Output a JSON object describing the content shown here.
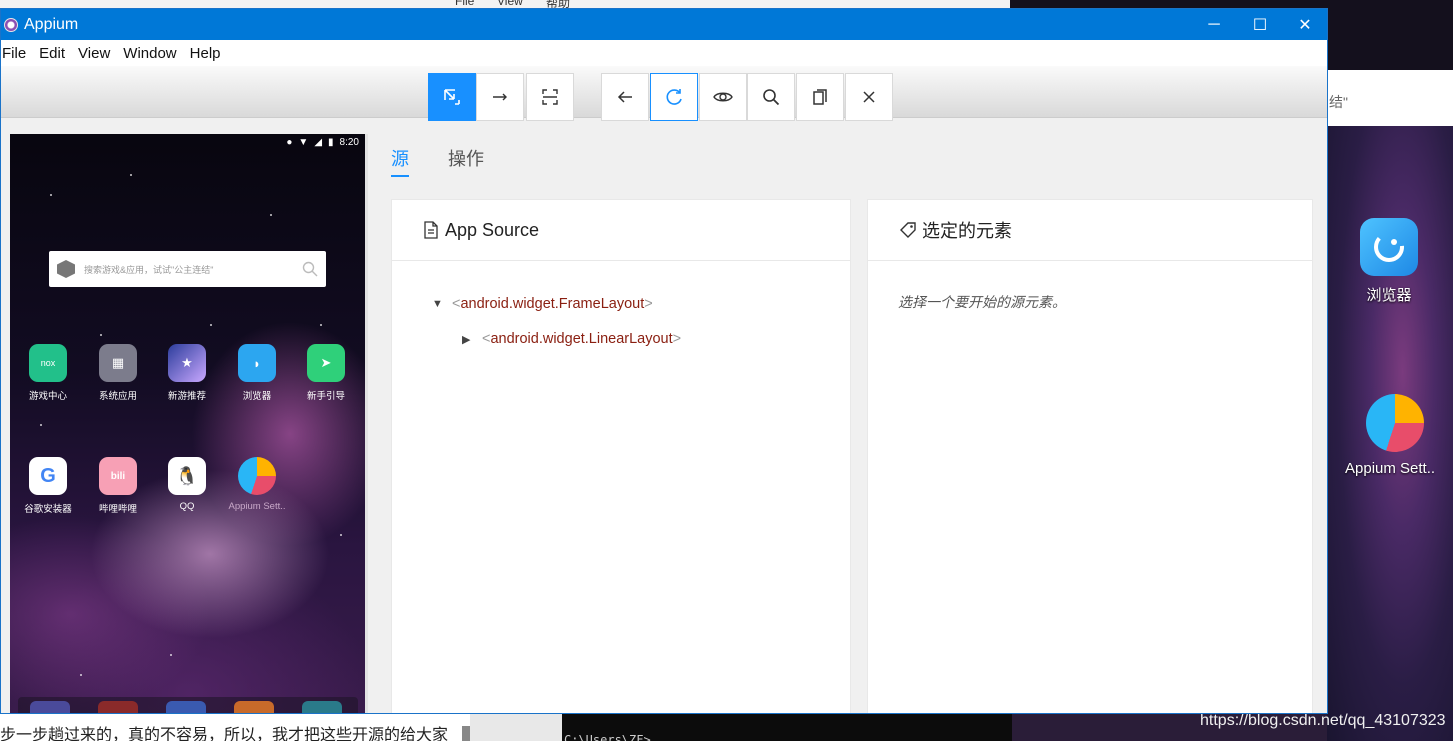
{
  "background": {
    "top_strip_items": [
      "File",
      "View",
      "帮助"
    ],
    "address_bar_text": "结\"",
    "desktop_icons": [
      {
        "label": "浏览器",
        "icon": "browser-icon"
      },
      {
        "label": "Appium Sett..",
        "icon": "appium-settings-icon"
      }
    ],
    "article_text": "步一步趟过来的，真的不容易，所以，我才把这些开源的给大家",
    "terminal_text": "C:\\Users\\ZF>",
    "watermark": "https://blog.csdn.net/qq_43107323"
  },
  "window": {
    "title": "Appium",
    "controls": {
      "minimize": "─",
      "maximize": "☐",
      "close": "✕"
    }
  },
  "menu": [
    "File",
    "Edit",
    "View",
    "Window",
    "Help"
  ],
  "toolbar": {
    "mode_buttons": [
      {
        "name": "select-elements",
        "icon": "select-cursor-icon",
        "active": true
      },
      {
        "name": "swipe-by-coordinates",
        "icon": "swipe-arrow-icon",
        "active": false
      },
      {
        "name": "tap-by-coordinates",
        "icon": "tap-frame-icon",
        "active": false
      }
    ],
    "action_buttons": [
      {
        "name": "back",
        "icon": "back-arrow-icon"
      },
      {
        "name": "refresh",
        "icon": "refresh-icon"
      },
      {
        "name": "show-hide-elements",
        "icon": "eye-icon"
      },
      {
        "name": "search-elements",
        "icon": "search-icon"
      },
      {
        "name": "copy-xml",
        "icon": "copy-icon"
      },
      {
        "name": "quit-session",
        "icon": "close-icon"
      }
    ]
  },
  "device": {
    "status_time": "8:20",
    "search_placeholder": "搜索游戏&应用，试试\"公主连结\"",
    "apps_row1": [
      {
        "label": "游戏中心",
        "color": "#22c08a",
        "glyph": "nox"
      },
      {
        "label": "系统应用",
        "color": "#7c7c8c",
        "glyph": "▦"
      },
      {
        "label": "新游推荐",
        "color": "#3a4aa8",
        "glyph": "★"
      },
      {
        "label": "浏览器",
        "color": "#2ca6f0",
        "glyph": "◗"
      },
      {
        "label": "新手引导",
        "color": "#2fd07a",
        "glyph": "➤"
      }
    ],
    "apps_row2": [
      {
        "label": "谷歌安装器",
        "color": "#ffffff",
        "glyph": "G"
      },
      {
        "label": "哔哩哔哩",
        "color": "#f7a0b5",
        "glyph": "bili"
      },
      {
        "label": "QQ",
        "color": "#ffffff",
        "glyph": "🐧"
      },
      {
        "label": "Appium Sett..",
        "color": "#e84d6a",
        "glyph": "◔"
      }
    ]
  },
  "tabs": [
    {
      "label": "源",
      "active": true
    },
    {
      "label": "操作",
      "active": false
    }
  ],
  "source_panel": {
    "title": "App Source",
    "tree": [
      {
        "tag": "android.widget.FrameLayout",
        "expanded": true
      },
      {
        "tag": "android.widget.LinearLayout",
        "expanded": false
      }
    ]
  },
  "selected_panel": {
    "title": "选定的元素",
    "hint": "选择一个要开始的源元素。"
  },
  "colors": {
    "accent": "#1890ff",
    "titlebar": "#0078d7",
    "xml_tag": "#8a1f11"
  }
}
